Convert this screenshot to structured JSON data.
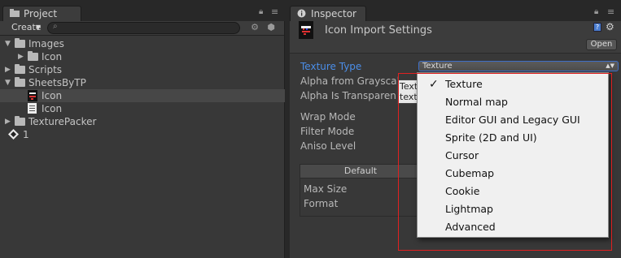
{
  "project": {
    "tab_label": "Project",
    "create_label": "Create",
    "search_value": "",
    "tree": [
      {
        "label": "Images",
        "expanded": true,
        "depth": 0,
        "type": "folder"
      },
      {
        "label": "Icon",
        "expanded": false,
        "depth": 1,
        "type": "folder"
      },
      {
        "label": "Scripts",
        "expanded": false,
        "depth": 0,
        "type": "folder"
      },
      {
        "label": "SheetsByTP",
        "expanded": true,
        "depth": 0,
        "type": "folder"
      },
      {
        "label": "Icon",
        "depth": 1,
        "type": "texture",
        "selected": true
      },
      {
        "label": "Icon",
        "depth": 1,
        "type": "text-file"
      },
      {
        "label": "TexturePacker",
        "expanded": false,
        "depth": 0,
        "type": "folder"
      },
      {
        "label": "1",
        "depth": 0,
        "type": "unity-scene"
      }
    ]
  },
  "inspector": {
    "tab_label": "Inspector",
    "title": "Icon Import Settings",
    "open_label": "Open",
    "texture_type_label": "Texture Type",
    "texture_type_value": "Texture",
    "alpha_from_grayscale_label": "Alpha from Grayscal",
    "alpha_is_transparency_label": "Alpha Is Transparen",
    "wrap_mode_label": "Wrap Mode",
    "filter_mode_label": "Filter Mode",
    "aniso_level_label": "Aniso Level",
    "platform_default_label": "Default",
    "max_size_label": "Max Size",
    "format_label": "Format",
    "tooltip_text": "Text text"
  },
  "popup_menu": {
    "items": [
      {
        "label": "Texture",
        "checked": true
      },
      {
        "label": "Normal map",
        "checked": false
      },
      {
        "label": "Editor GUI and Legacy GUI",
        "checked": false
      },
      {
        "label": "Sprite (2D and UI)",
        "checked": false
      },
      {
        "label": "Cursor",
        "checked": false
      },
      {
        "label": "Cubemap",
        "checked": false
      },
      {
        "label": "Cookie",
        "checked": false
      },
      {
        "label": "Lightmap",
        "checked": false
      },
      {
        "label": "Advanced",
        "checked": false
      }
    ],
    "check_glyph": "✓"
  },
  "colors": {
    "panel_bg": "#383838",
    "active_label": "#4b8ee8",
    "highlight_outline": "#e02020",
    "menu_bg": "#f0f0f0"
  }
}
